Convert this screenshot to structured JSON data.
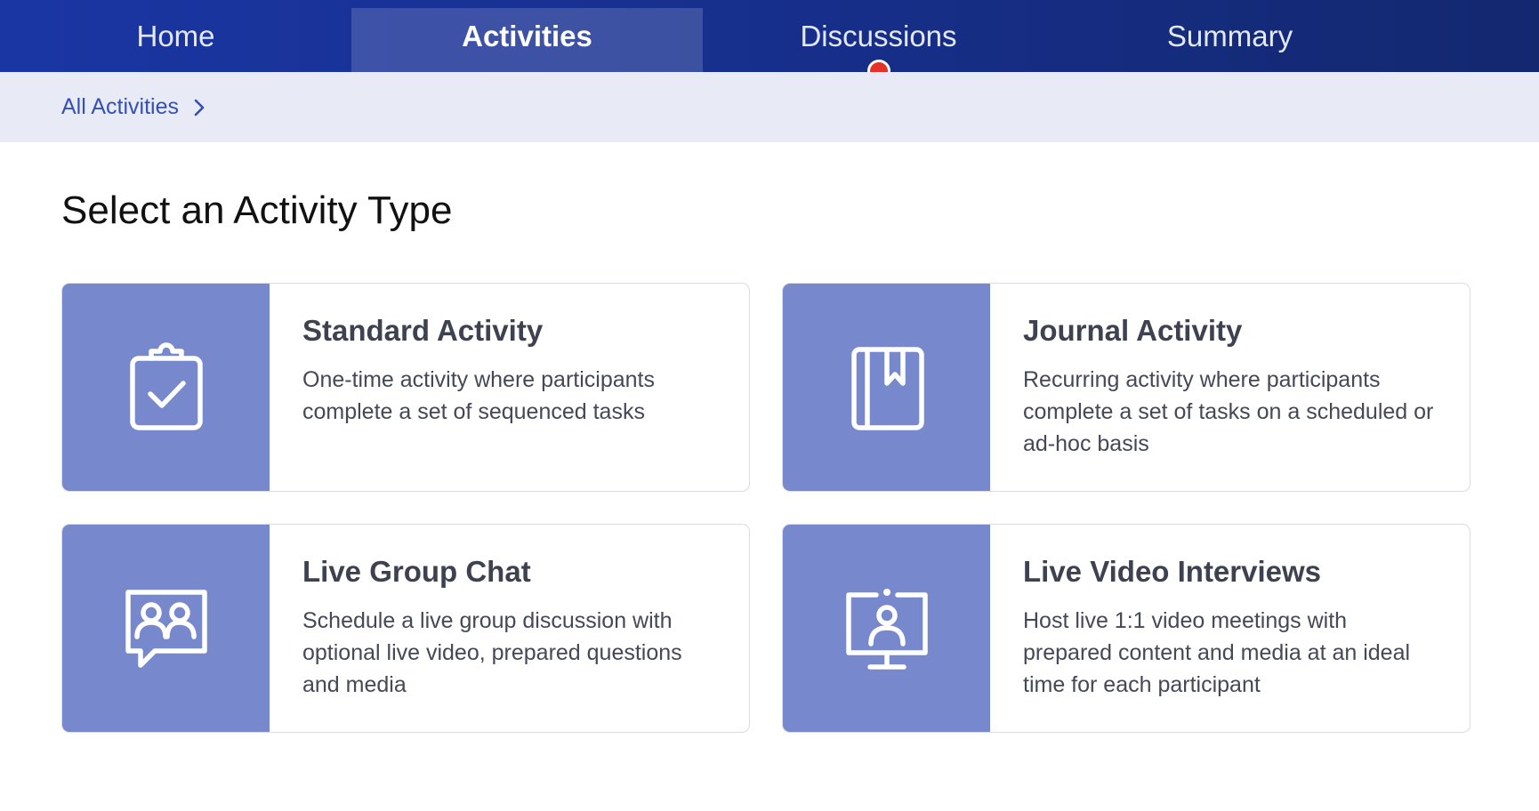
{
  "nav": {
    "tabs": [
      {
        "label": "Home",
        "active": false
      },
      {
        "label": "Activities",
        "active": true
      },
      {
        "label": "Discussions",
        "active": false,
        "notification": true
      },
      {
        "label": "Summary",
        "active": false
      }
    ],
    "notification_color": "#e4322b"
  },
  "breadcrumb": {
    "label": "All Activities",
    "icon": "chevron-right-icon"
  },
  "page": {
    "title": "Select an Activity Type"
  },
  "cards": [
    {
      "title": "Standard Activity",
      "description": "One-time activity where participants complete a set of sequenced tasks",
      "icon": "clipboard-check-icon"
    },
    {
      "title": "Journal Activity",
      "description": "Recurring activity where participants complete a set of tasks on a scheduled or ad-hoc basis",
      "icon": "journal-bookmark-icon"
    },
    {
      "title": "Live Group Chat",
      "description": "Schedule a live group discussion with optional live video, prepared questions and media",
      "icon": "group-chat-icon"
    },
    {
      "title": "Live Video Interviews",
      "description": "Host live 1:1 video meetings with prepared content and media at an ideal time for each participant",
      "icon": "video-monitor-icon"
    }
  ],
  "colors": {
    "nav_bg": "#1a36a3",
    "breadcrumb_bg": "#e8ebf6",
    "link": "#3450b5",
    "icon_panel": "#7788cc"
  }
}
